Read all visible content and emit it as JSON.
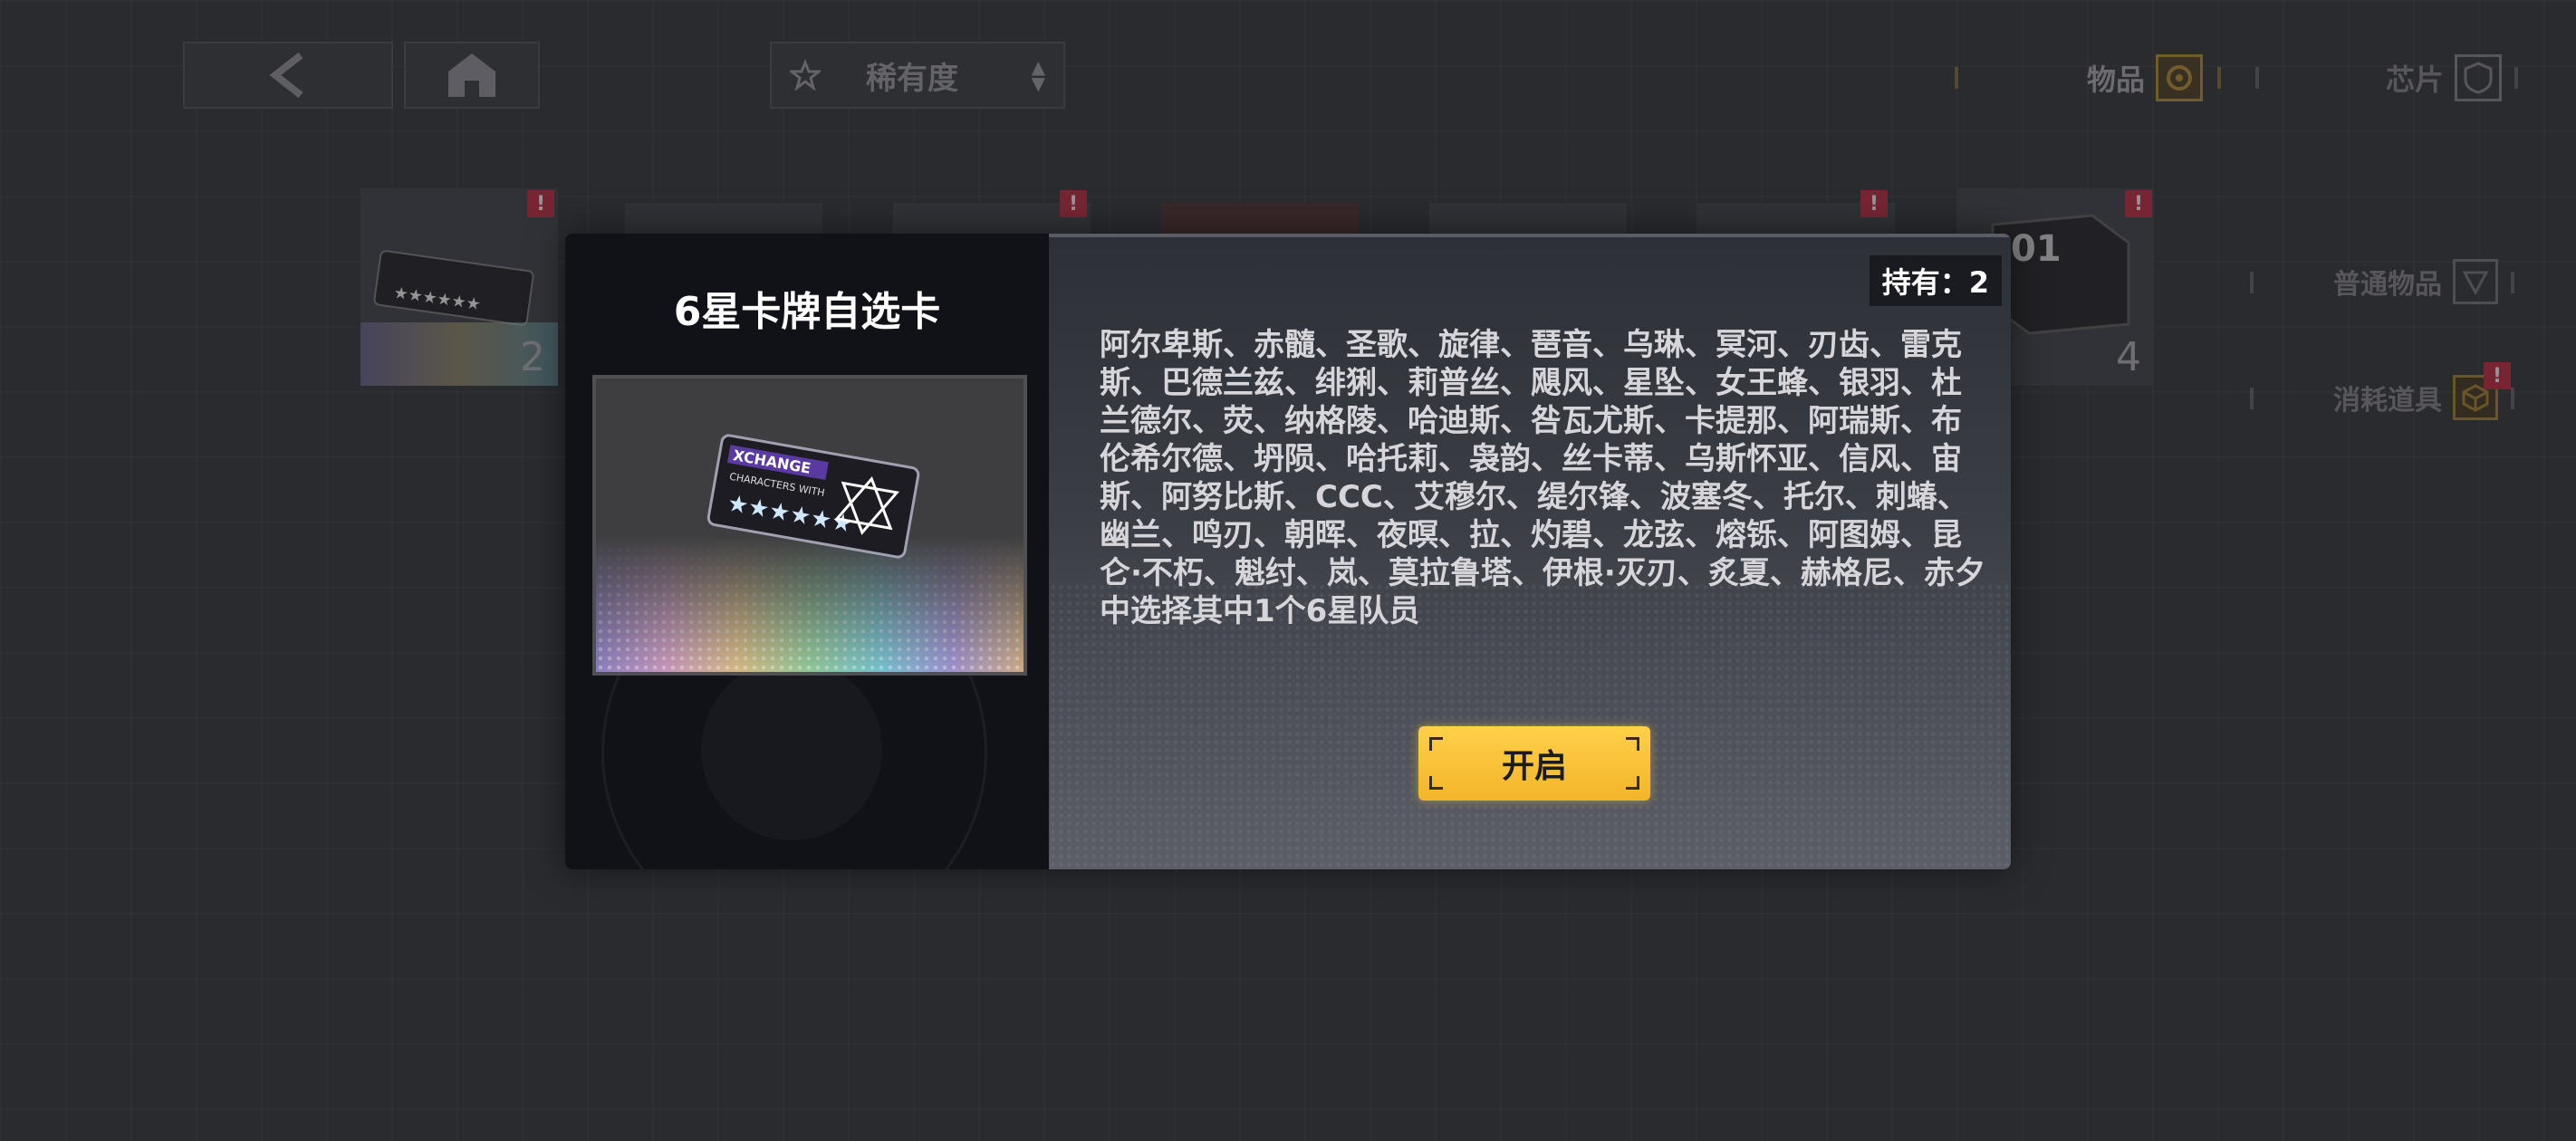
{
  "topbar": {
    "back_icon": "chevron-left-icon",
    "home_icon": "home-icon",
    "sort": {
      "icon": "star-icon",
      "label": "稀有度",
      "arrows": "updown-icon"
    },
    "tabs": [
      {
        "label": "物品",
        "icon": "items-icon",
        "active": true
      },
      {
        "label": "芯片",
        "icon": "chip-shield-icon",
        "active": false
      }
    ]
  },
  "side_tabs": [
    {
      "label": "普通物品",
      "icon": "common-items-icon",
      "alert": false
    },
    {
      "label": "消耗道具",
      "icon": "consumable-cube-icon",
      "alert": true
    }
  ],
  "inventory": [
    {
      "count": "2",
      "alert": true
    },
    {
      "count": "",
      "alert": false
    },
    {
      "count": "",
      "alert": true
    },
    {
      "count": "",
      "alert": false
    },
    {
      "count": "",
      "alert": false
    },
    {
      "count": "",
      "alert": true
    },
    {
      "count": "4",
      "alert": true,
      "label": "01"
    }
  ],
  "alert_mark": "!",
  "dialog": {
    "title": "6星卡牌自选卡",
    "owned_label": "持有：",
    "owned_count": "2",
    "owned_text": "持有：2",
    "description": "阿尔卑斯、赤髓、圣歌、旋律、琶音、乌琳、冥河、刃齿、雷克斯、巴德兰兹、绯猁、莉普丝、飓风、星坠、女王蜂、银羽、杜兰德尔、荧、纳格陵、哈迪斯、咎瓦尤斯、卡提那、阿瑞斯、布伦希尔德、坍陨、哈托莉、袅韵、丝卡蒂、乌斯怀亚、信风、宙斯、阿努比斯、CCC、艾穆尔、缇尔锋、波塞冬、托尔、刺蝽、幽兰、鸣刃、朝晖、夜暝、拉、灼碧、龙弦、熔铄、阿图姆、昆仑·不朽、魁纣、岚、莫拉鲁塔、伊根·灭刃、炙夏、赫格尼、赤夕中选择其中1个6星队员",
    "open_button": "开启",
    "card_image": {
      "header": "XCHANGE",
      "subheader": "CHARACTERS WITH",
      "stars": "★★★★★★"
    }
  },
  "colors": {
    "accent": "#f3b52a",
    "alert": "#c8334a",
    "background": "#3d3e43"
  }
}
